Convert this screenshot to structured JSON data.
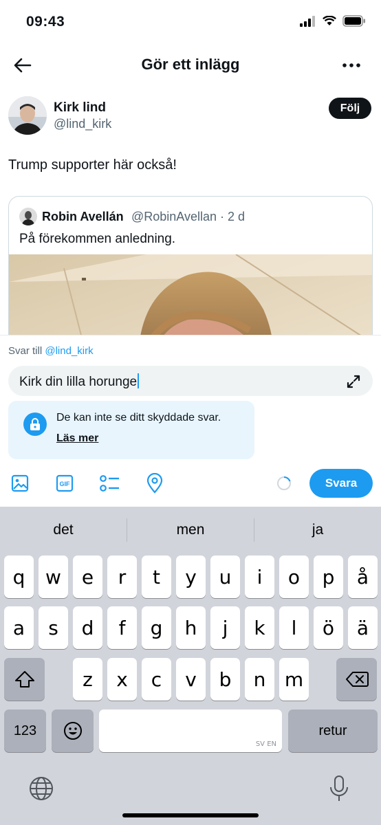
{
  "status": {
    "time": "09:43"
  },
  "header": {
    "title": "Gör ett inlägg"
  },
  "author": {
    "name": "Kirk lind",
    "handle": "@lind_kirk",
    "follow_label": "Följ"
  },
  "tweet": {
    "text": "Trump supporter här också!"
  },
  "quote": {
    "name": "Robin Avellán",
    "handle": "@RobinAvellan · 2 d",
    "text": "På förekommen anledning."
  },
  "reply": {
    "reply_to_prefix": "Svar till",
    "reply_to_mention": "@lind_kirk",
    "input_value": "Kirk din lilla horunge",
    "notice_text": "De kan inte se ditt skyddade svar.",
    "notice_link": "Läs mer",
    "submit_label": "Svara"
  },
  "toolbar": {
    "icons": [
      "image-icon",
      "gif-icon",
      "poll-icon",
      "location-icon"
    ]
  },
  "keyboard": {
    "suggestions": [
      "det",
      "men",
      "ja"
    ],
    "row1": [
      "q",
      "w",
      "e",
      "r",
      "t",
      "y",
      "u",
      "i",
      "o",
      "p",
      "å"
    ],
    "row2": [
      "a",
      "s",
      "d",
      "f",
      "g",
      "h",
      "j",
      "k",
      "l",
      "ö",
      "ä"
    ],
    "row3": [
      "z",
      "x",
      "c",
      "v",
      "b",
      "n",
      "m"
    ],
    "numbers_label": "123",
    "return_label": "retur",
    "space_languages": "SV EN"
  },
  "colors": {
    "accent": "#1d9bf0",
    "text": "#0f1419",
    "muted": "#536471",
    "keyboard_bg": "#d1d4db"
  }
}
